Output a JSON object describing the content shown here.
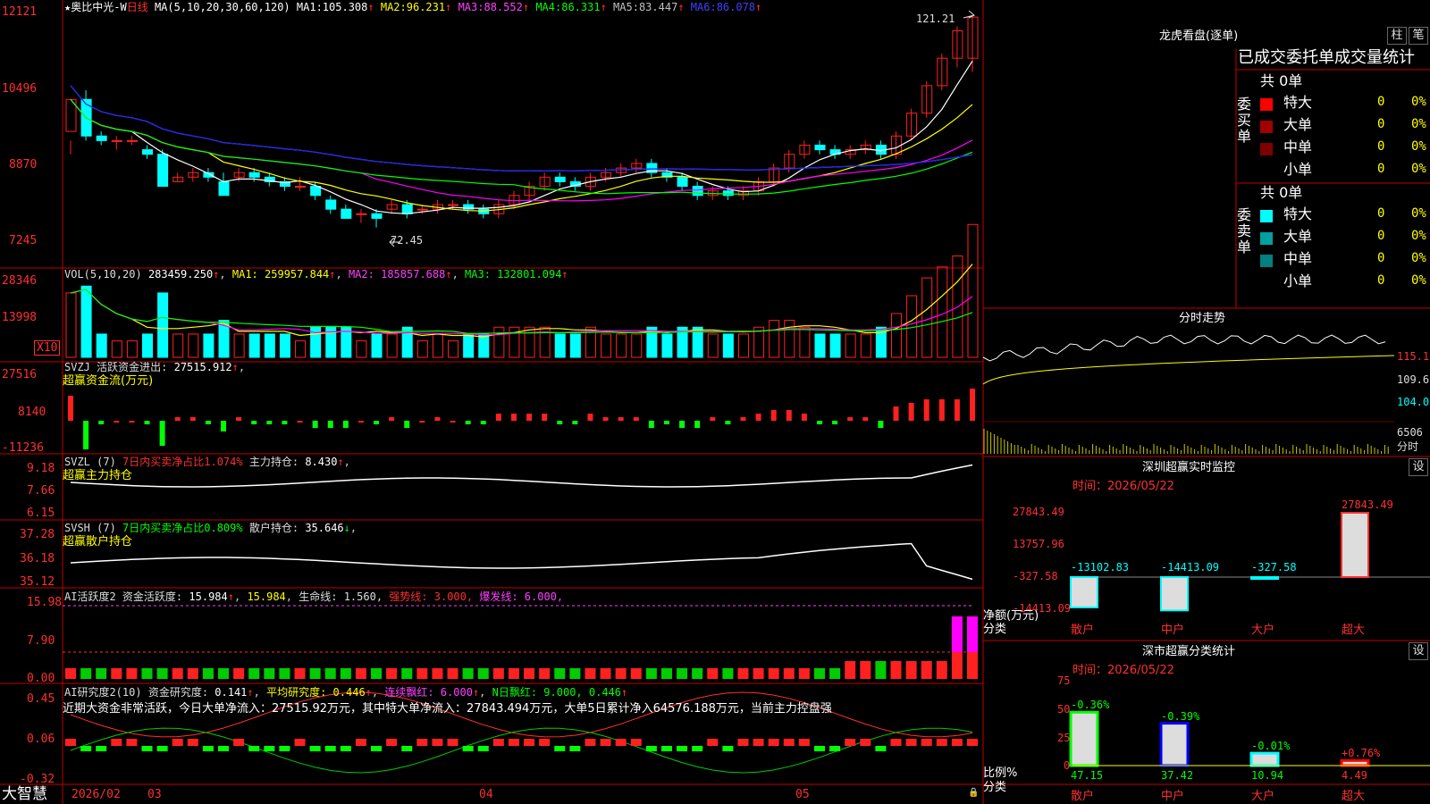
{
  "colors": {
    "up": "#ff2020",
    "down": "#00ffff",
    "ma1": "#ffffff",
    "ma2": "#ffff00",
    "ma3": "#ff00ff",
    "ma4": "#00ff00",
    "ma5": "#a0a0a0",
    "ma6": "#2020ff",
    "axis": "#ff3030",
    "frame": "#c00000"
  },
  "header": {
    "star": "★",
    "name": "奥比中光-W",
    "period": "日线",
    "ma_params": "MA(5,10,20,30,60,120)",
    "ma": [
      {
        "label": "MA1:",
        "value": "105.308"
      },
      {
        "label": "MA2:",
        "value": "96.231"
      },
      {
        "label": "MA3:",
        "value": "88.552"
      },
      {
        "label": "MA4:",
        "value": "86.331"
      },
      {
        "label": "MA5:",
        "value": "83.447"
      },
      {
        "label": "MA6:",
        "value": "86.078"
      }
    ],
    "arrow": "↑"
  },
  "kline": {
    "ylabels": [
      "12121",
      "10496",
      "8870",
      "7245"
    ],
    "high_label": "121.21",
    "low_label": "72.45",
    "candles": [
      [
        96,
        103,
        94,
        91
      ],
      [
        103,
        95,
        105,
        94
      ],
      [
        95,
        94,
        96,
        93
      ],
      [
        94,
        94,
        95,
        92
      ],
      [
        94,
        94,
        95,
        93
      ],
      [
        92,
        91,
        93,
        90
      ],
      [
        91,
        84,
        92,
        84
      ],
      [
        85,
        86,
        87,
        85
      ],
      [
        86,
        87,
        88,
        85
      ],
      [
        87,
        86,
        88,
        85
      ],
      [
        85,
        82,
        87,
        82
      ],
      [
        86,
        87,
        88,
        85
      ],
      [
        87,
        86,
        88,
        85
      ],
      [
        86,
        85,
        87,
        84
      ],
      [
        85,
        84,
        86,
        83
      ],
      [
        84,
        84,
        86,
        83
      ],
      [
        84,
        82,
        85,
        81
      ],
      [
        81,
        79,
        82,
        78
      ],
      [
        79,
        77,
        80,
        77
      ],
      [
        78,
        78,
        79,
        76
      ],
      [
        78,
        77,
        79,
        75
      ],
      [
        79,
        80,
        81,
        78
      ],
      [
        80,
        78,
        81,
        77
      ],
      [
        79,
        79,
        80,
        78
      ],
      [
        79,
        80,
        81,
        78
      ],
      [
        80,
        80,
        81,
        79
      ],
      [
        80,
        79,
        81,
        78
      ],
      [
        79,
        78,
        80,
        77
      ],
      [
        78,
        80,
        81,
        77
      ],
      [
        80,
        82,
        83,
        79
      ],
      [
        82,
        84,
        85,
        81
      ],
      [
        84,
        86,
        87,
        83
      ],
      [
        86,
        85,
        87,
        84
      ],
      [
        85,
        84,
        86,
        83
      ],
      [
        84,
        86,
        87,
        83
      ],
      [
        86,
        87,
        88,
        85
      ],
      [
        87,
        88,
        89,
        86
      ],
      [
        88,
        89,
        90,
        87
      ],
      [
        89,
        87,
        90,
        86
      ],
      [
        87,
        86,
        88,
        85
      ],
      [
        86,
        84,
        87,
        83
      ],
      [
        84,
        82,
        85,
        81
      ],
      [
        82,
        83,
        84,
        81
      ],
      [
        83,
        82,
        84,
        81
      ],
      [
        82,
        83,
        84,
        81
      ],
      [
        83,
        85,
        86,
        82
      ],
      [
        85,
        88,
        89,
        84
      ],
      [
        88,
        91,
        92,
        87
      ],
      [
        91,
        93,
        94,
        90
      ],
      [
        93,
        92,
        94,
        91
      ],
      [
        92,
        91,
        93,
        90
      ],
      [
        91,
        92,
        93,
        90
      ],
      [
        92,
        93,
        94,
        91
      ],
      [
        93,
        91,
        94,
        90
      ],
      [
        91,
        95,
        96,
        90
      ],
      [
        95,
        100,
        101,
        94
      ],
      [
        100,
        106,
        107,
        99
      ],
      [
        106,
        112,
        113,
        105
      ],
      [
        112,
        118,
        119,
        110
      ],
      [
        112,
        121,
        121,
        109
      ]
    ]
  },
  "vol": {
    "title": "VOL(5,10,20)",
    "value": "283459.250",
    "ma1_label": "MA1:",
    "ma1": "259957.844",
    "ma2_label": "MA2:",
    "ma2": "185857.688",
    "ma3_label": "MA3:",
    "ma3": "132801.094",
    "ylabels": [
      "28346",
      "13998"
    ],
    "unit": "X10"
  },
  "svzj": {
    "title": "SVZJ",
    "label": "活跃资金进出:",
    "value": "27515.912",
    "sub": "超赢资金流(万元)",
    "ylabels": [
      "27516",
      "8140",
      "-11236"
    ]
  },
  "svzl": {
    "title": "SVZL (7)",
    "desc": "7日内买卖净占比1.074%",
    "label": "主力持仓:",
    "value": "8.430",
    "sub": "超赢主力持仓",
    "ylabels": [
      "9.18",
      "7.66",
      "6.15"
    ]
  },
  "svsh": {
    "title": "SVSH (7)",
    "desc": "7日内买卖净占比0.809%",
    "label": "散户持仓:",
    "value": "35.646",
    "sub": "超赢散户持仓",
    "ylabels": [
      "37.28",
      "36.18",
      "35.12"
    ]
  },
  "ai1": {
    "title": "AI活跃度2",
    "label": "资金活跃度:",
    "v1": "15.984",
    "v2": "15.984",
    "life": "生命线: 1.560,",
    "strong": "强势线: 3.000,",
    "burst": "爆发线: 6.000,",
    "ylabels": [
      "15.98",
      "7.90",
      "0.00"
    ]
  },
  "ai2": {
    "title": "AI研究度2(10)",
    "label": "资金研究度:",
    "value": "0.141",
    "avg": "平均研究度: 0.446",
    "lian": "连续飘红: 6.000",
    "nri": "N日飘红: 9.000, 0.446",
    "note": "近期大资金非常活跃，今日大单净流入：27515.92万元，其中特大单净流入：27843.494万元，大单5日累计净入64576.188万元，当前主力控盘强",
    "ylabels": [
      "0.45",
      "0.06",
      "-0.32"
    ]
  },
  "bottom": {
    "logo": "大智慧",
    "dates": [
      "2026/02",
      "03",
      "04",
      "05"
    ]
  },
  "right": {
    "lhb_title": "龙虎看盘(逐单)",
    "btn1": "柱",
    "btn2": "笔",
    "stat_title": "已成交委托单成交量统计",
    "buy_label": "委买单",
    "sell_label": "委卖单",
    "buy_total": "共 0单",
    "sell_total": "共 0单",
    "rows": [
      {
        "name": "特大",
        "n": "0",
        "p": "0%"
      },
      {
        "name": "大单",
        "n": "0",
        "p": "0%"
      },
      {
        "name": "中单",
        "n": "0",
        "p": "0%"
      },
      {
        "name": "小单",
        "n": "0",
        "p": "0%"
      }
    ],
    "fs_title": "分时走势",
    "fs_ylabels": [
      "115.1",
      "109.6",
      "104.0"
    ],
    "fs_vol": "6506",
    "fs_unit": "分时",
    "mon_title": "深圳超赢实时监控",
    "mon_btn": "设",
    "mon_time": "时间：2026/05/22",
    "mon_ylabels": [
      "27843.49",
      "13757.96",
      "-327.58",
      "-14413.09"
    ],
    "mon_side": "净额(万元)",
    "mon_side2": "分类",
    "mon_bars": [
      {
        "cat": "散户",
        "val": -13102.83,
        "label": "-13102.83"
      },
      {
        "cat": "中户",
        "val": -14413.09,
        "label": "-14413.09"
      },
      {
        "cat": "大户",
        "val": -327.58,
        "label": "-327.58"
      },
      {
        "cat": "超大",
        "val": 27843.49,
        "label": "27843.49"
      }
    ],
    "cls_title": "深市超赢分类统计",
    "cls_btn": "设",
    "cls_time": "时间：2026/05/22",
    "cls_ylabels": [
      "75",
      "50",
      "25",
      "0"
    ],
    "cls_side": "比例%",
    "cls_side2": "分类",
    "cls_bars": [
      {
        "cat": "散户",
        "val": 47.15,
        "label": "47.15",
        "chg": "-0.36%"
      },
      {
        "cat": "中户",
        "val": 37.42,
        "label": "37.42",
        "chg": "-0.39%"
      },
      {
        "cat": "大户",
        "val": 10.94,
        "label": "10.94",
        "chg": "-0.01%"
      },
      {
        "cat": "超大",
        "val": 4.49,
        "label": "4.49",
        "chg": "+0.76%"
      }
    ]
  }
}
